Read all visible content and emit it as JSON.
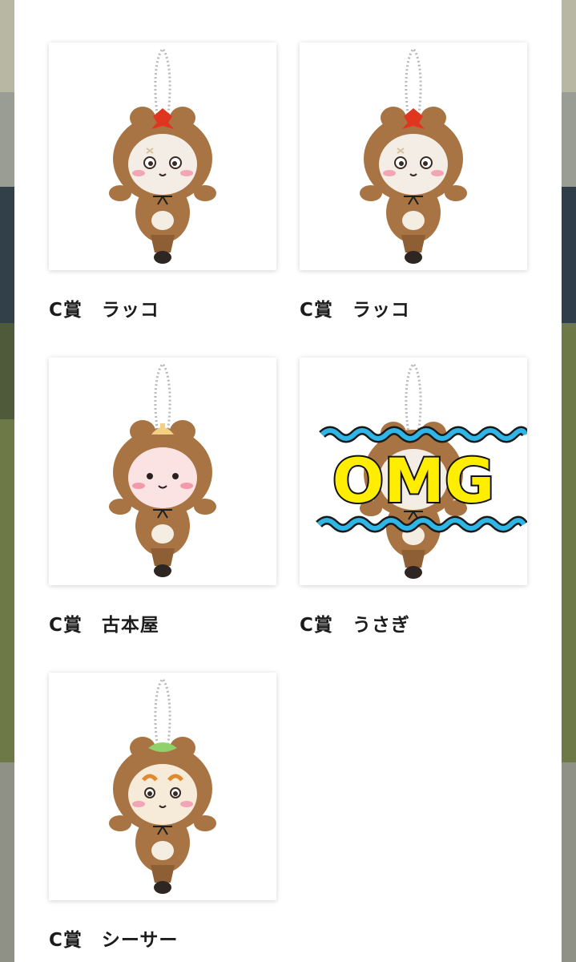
{
  "colors": {
    "modal_bg": "#ffffff",
    "overlay": "#8f9187",
    "text": "#1c1c1c",
    "plush_brown": "#a87443",
    "omg_fill": "#ffee00",
    "wave_blue": "#2fb6e6"
  },
  "products": [
    {
      "caption": "C賞　ラッコ",
      "accessory": "red-maple-leaf",
      "face": "pale",
      "sticker": ""
    },
    {
      "caption": "C賞　ラッコ",
      "accessory": "red-maple-leaf",
      "face": "pale",
      "sticker": ""
    },
    {
      "caption": "C賞　古本屋",
      "accessory": "yellow-acorn-cap",
      "face": "pink",
      "sticker": ""
    },
    {
      "caption": "C賞　うさぎ",
      "accessory": "red-maple-leaf",
      "face": "pale",
      "sticker": "OMG"
    },
    {
      "caption": "C賞　シーサー",
      "accessory": "green-leaf",
      "face": "shisa",
      "sticker": ""
    }
  ]
}
